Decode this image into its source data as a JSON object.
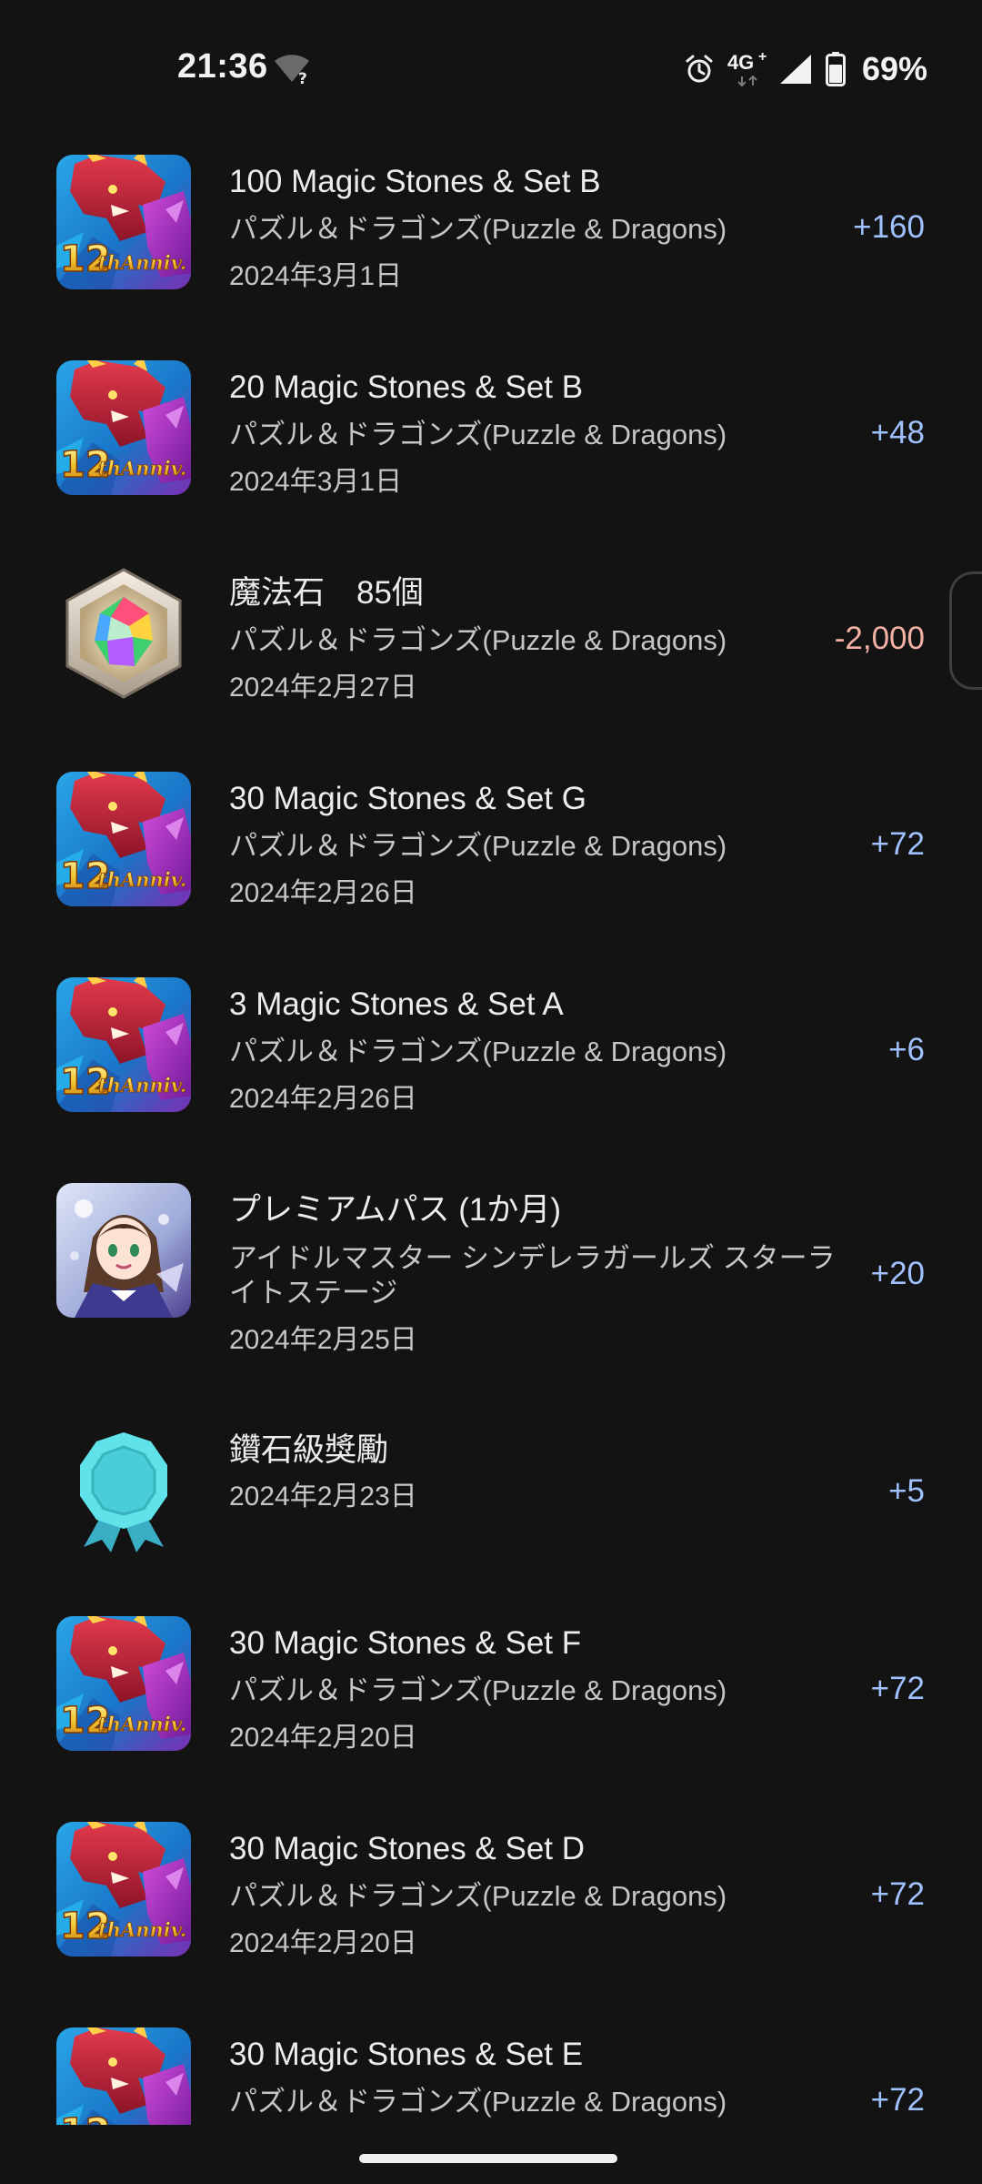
{
  "status_bar": {
    "time": "21:36",
    "network": "4G",
    "network_plus": "+",
    "battery_percent": "69%",
    "icons": [
      "wifi-unknown-icon",
      "alarm-icon",
      "network-4g-icon",
      "cell-signal-icon",
      "battery-icon"
    ]
  },
  "transactions": [
    {
      "icon": "puzzle-dragons-12th-app-icon",
      "title": "100 Magic Stones & Set B",
      "app": "パズル＆ドラゴンズ(Puzzle & Dragons)",
      "date": "2024年3月1日",
      "amount": "+160",
      "amount_type": "positive"
    },
    {
      "icon": "puzzle-dragons-12th-app-icon",
      "title": "20 Magic Stones & Set B",
      "app": "パズル＆ドラゴンズ(Puzzle & Dragons)",
      "date": "2024年3月1日",
      "amount": "+48",
      "amount_type": "positive"
    },
    {
      "icon": "magic-stone-icon",
      "title": "魔法石　85個",
      "app": "パズル＆ドラゴンズ(Puzzle & Dragons)",
      "date": "2024年2月27日",
      "amount": "-2,000",
      "amount_type": "negative"
    },
    {
      "icon": "puzzle-dragons-12th-app-icon",
      "title": "30 Magic Stones & Set G",
      "app": "パズル＆ドラゴンズ(Puzzle & Dragons)",
      "date": "2024年2月26日",
      "amount": "+72",
      "amount_type": "positive"
    },
    {
      "icon": "puzzle-dragons-12th-app-icon",
      "title": "3 Magic Stones & Set A",
      "app": "パズル＆ドラゴンズ(Puzzle & Dragons)",
      "date": "2024年2月26日",
      "amount": "+6",
      "amount_type": "positive"
    },
    {
      "icon": "idolmaster-starlight-app-icon",
      "title": "プレミアムパス (1か月)",
      "app_line1": "アイドルマスター シンデレラガールズ スターラ",
      "app_line2": "イトステージ",
      "date": "2024年2月25日",
      "amount": "+20",
      "amount_type": "positive"
    },
    {
      "icon": "diamond-tier-badge-icon",
      "title": "鑽石級獎勵",
      "date": "2024年2月23日",
      "amount": "+5",
      "amount_type": "positive"
    },
    {
      "icon": "puzzle-dragons-12th-app-icon",
      "title": "30 Magic Stones & Set F",
      "app": "パズル＆ドラゴンズ(Puzzle & Dragons)",
      "date": "2024年2月20日",
      "amount": "+72",
      "amount_type": "positive"
    },
    {
      "icon": "puzzle-dragons-12th-app-icon",
      "title": "30 Magic Stones & Set D",
      "app": "パズル＆ドラゴンズ(Puzzle & Dragons)",
      "date": "2024年2月20日",
      "amount": "+72",
      "amount_type": "positive"
    },
    {
      "icon": "puzzle-dragons-12th-app-icon",
      "title": "30 Magic Stones & Set E",
      "app": "パズル＆ドラゴンズ(Puzzle & Dragons)",
      "amount": "+72",
      "amount_type": "positive"
    }
  ],
  "icon_art": {
    "pad_badge_text": "12thAnniv."
  },
  "colors": {
    "background": "#131313",
    "positive_amount": "#9fc1ff",
    "negative_amount": "#f3b1a3",
    "primary_text": "#ececec",
    "secondary_text": "#c6c6c6"
  }
}
